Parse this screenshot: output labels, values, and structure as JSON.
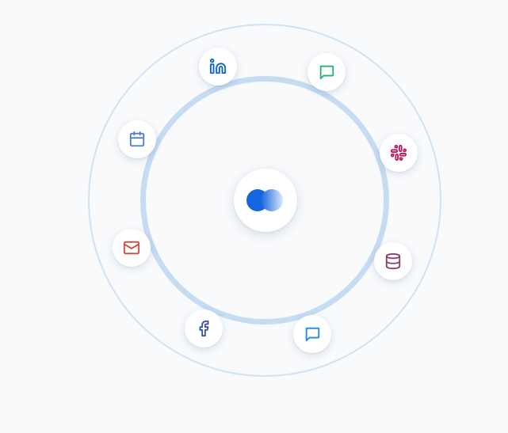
{
  "diagram": {
    "hub_icon": "app-logo",
    "integrations": [
      {
        "name": "linkedin",
        "icon": "linkedin-icon",
        "color": "#0a66c2"
      },
      {
        "name": "chat",
        "icon": "chat-bubble-icon",
        "color": "#22b573"
      },
      {
        "name": "calendar",
        "icon": "calendar-icon",
        "color": "#4a7fd4"
      },
      {
        "name": "slack",
        "icon": "slack-icon",
        "color": "#c2185b"
      },
      {
        "name": "mail",
        "icon": "mail-icon",
        "color": "#d14836"
      },
      {
        "name": "database",
        "icon": "database-icon",
        "color": "#8e3a6e"
      },
      {
        "name": "facebook",
        "icon": "facebook-icon",
        "color": "#3b4fa0"
      },
      {
        "name": "chat",
        "icon": "chat-bubble-icon",
        "color": "#1e88e5"
      }
    ],
    "colors": {
      "background": "#f8fafc",
      "ring_outer": "#cfe3f5",
      "ring_inner": "#c6dcf3",
      "logo_left": "#1565e0",
      "logo_right": "#9cc2f3"
    }
  }
}
